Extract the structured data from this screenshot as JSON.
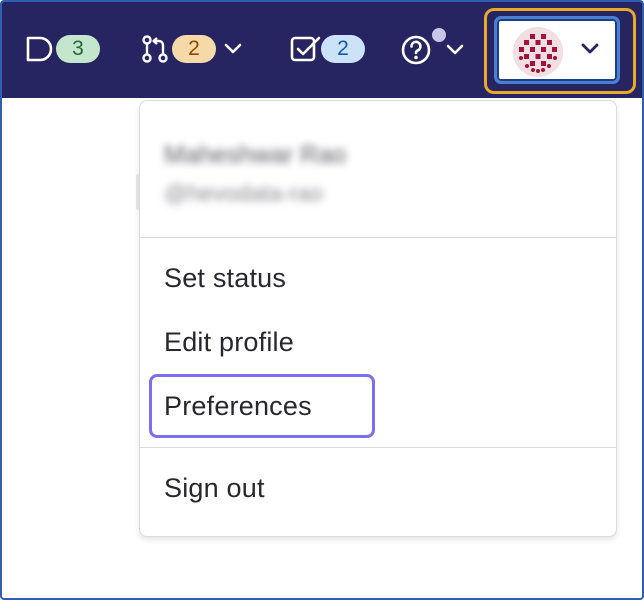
{
  "navbar": {
    "issues": {
      "icon": "issues-icon",
      "count": "3"
    },
    "merge_requests": {
      "icon": "merge-request-icon",
      "count": "2"
    },
    "todos": {
      "icon": "todo-checkbox-icon",
      "count": "2"
    },
    "help": {
      "icon": "question-circle-icon"
    },
    "user": {
      "icon": "avatar"
    }
  },
  "dropdown": {
    "user_name": "Maheshwar Rao",
    "user_handle": "@hevodata-rao",
    "items": [
      {
        "label": "Set status"
      },
      {
        "label": "Edit profile"
      },
      {
        "label": "Preferences"
      },
      {
        "label": "Sign out"
      }
    ]
  },
  "colors": {
    "navbar_bg": "#262461",
    "highlight_outline": "#e9a92a",
    "focus_ring": "#7b6ef0",
    "badge_green": "#c3e6cd",
    "badge_orange": "#f5d9a8",
    "badge_blue": "#cbe2f9"
  }
}
